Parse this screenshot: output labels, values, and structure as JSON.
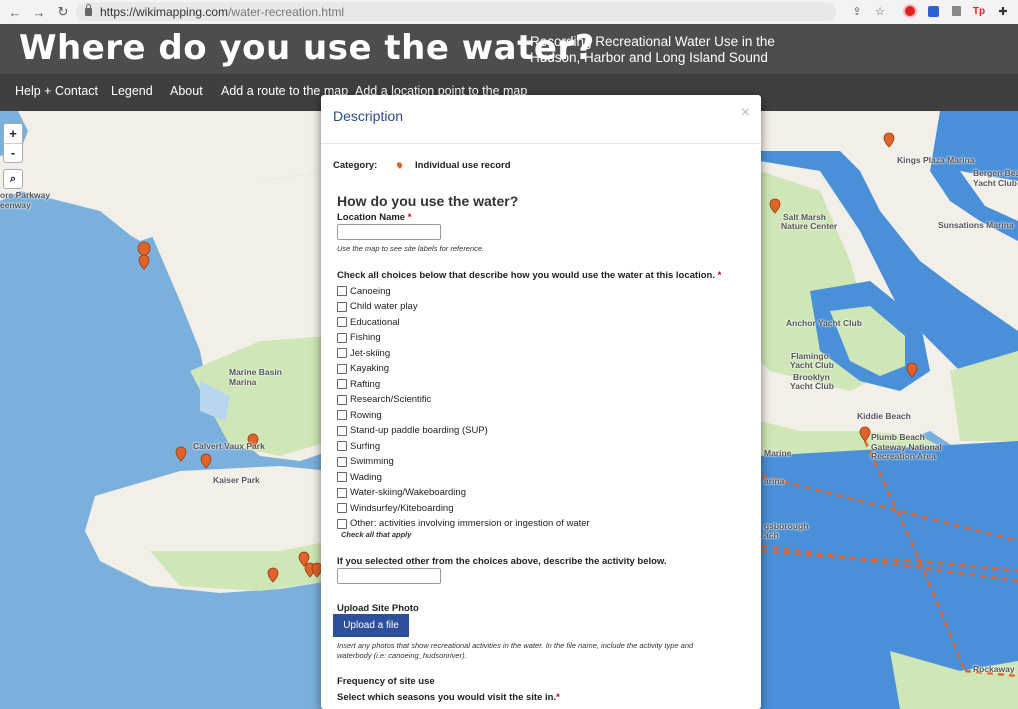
{
  "browser": {
    "url_domain": "https://wikimapping.com",
    "url_path": "/water-recreation.html"
  },
  "header": {
    "title": "Where do you use the water?",
    "subtitle_line1": "Recording Recreational Water Use in the",
    "subtitle_line2": "Hudson, Harbor and Long Island Sound"
  },
  "nav": {
    "items": [
      "Help + Contact",
      "Legend",
      "About",
      "Add a route to the map",
      "Add a location point to the map"
    ]
  },
  "map": {
    "zoom_in": "+",
    "zoom_out": "-",
    "labels": {
      "shore_parkway": "ore Parkway",
      "greenway": "eenway",
      "marine_basin": "Marine Basin",
      "marina": "Marina",
      "calvert_vaux": "Calvert Vaux Park",
      "kaiser_park": "Kaiser Park",
      "kings_plaza": "Kings Plaza Marina",
      "bergen_beach_1": "Bergen Bea",
      "bergen_beach_2": "Yacht Club",
      "salt_marsh_1": "Salt Marsh",
      "salt_marsh_2": "Nature Center",
      "sunsations": "Sunsations Marina",
      "anchor_yacht": "Anchor Yacht Club",
      "flamingo_1": "Flamingo",
      "flamingo_2": "Yacht Club",
      "brooklyn_1": "Brooklyn",
      "brooklyn_2": "Yacht Club",
      "kiddie_beach": "Kiddie Beach",
      "plumb_1": "Plumb Beach",
      "plumb_2": "Gateway National",
      "plumb_3": "Recreation Area",
      "marine_r": "Marine",
      "arina_r": "arina",
      "gsborough_1": "gsborough",
      "gsborough_2": "ach",
      "rockaway": "Rockaway"
    },
    "colors": {
      "water": "#7cb0dc",
      "deep_water": "#4a90d9",
      "land": "#f2efe9",
      "park": "#cfe7b6",
      "pin": "#e0642a"
    }
  },
  "modal": {
    "title": "Description",
    "close": "×",
    "category_label": "Category:",
    "category_value": "Individual use record",
    "heading": "How do you use the water?",
    "location_label": "Location Name",
    "required_mark": "*",
    "location_hint": "Use the map to see site labels for reference.",
    "checks_label": "Check all choices below that describe how you would use the water at this location.",
    "choices": [
      "Canoeing",
      "Child water play",
      "Educational",
      "Fishing",
      "Jet-skiing",
      "Kayaking",
      "Rafting",
      "Research/Scientific",
      "Rowing",
      "Stand-up paddle boarding (SUP)",
      "Surfing",
      "Swimming",
      "Wading",
      "Water-skiing/Wakeboarding",
      "Windsurfey/Kiteboarding",
      "Other: activities involving immersion or ingestion of water"
    ],
    "check_all_hint": "Check all that apply",
    "other_label": "If you selected other from the choices above, describe the activity below.",
    "upload_label": "Upload Site Photo",
    "upload_button": "Upload a file",
    "upload_hint_1": "Insert any photos that show recreational activities in the water. In the file name, include the activity type and",
    "upload_hint_2": "waterbody (i.e: canoeing_hudsonriver).",
    "frequency_label": "Frequency of site use",
    "seasons_label": "Select which seasons you would visit the site in."
  }
}
